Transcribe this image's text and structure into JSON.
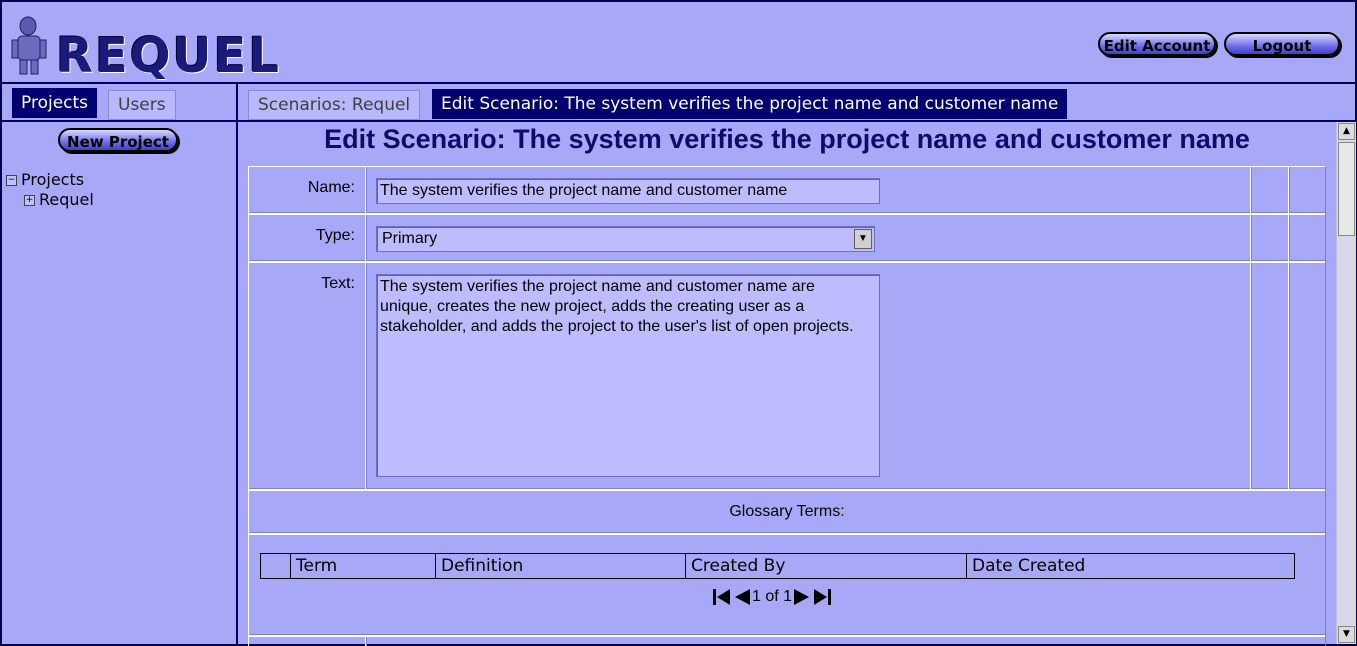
{
  "header": {
    "logo_text": "REQUEL",
    "edit_account_label": "Edit Account",
    "logout_label": "Logout"
  },
  "left_panel": {
    "tabs": [
      {
        "label": "Projects",
        "active": true
      },
      {
        "label": "Users",
        "active": false
      }
    ],
    "new_project_label": "New Project",
    "tree": {
      "root": {
        "label": "Projects",
        "toggle": "⊟"
      },
      "children": [
        {
          "label": "Requel",
          "toggle": "⊞"
        }
      ]
    }
  },
  "right_panel": {
    "tabs": [
      {
        "label": "Scenarios: Requel",
        "active": false
      },
      {
        "label": "Edit Scenario: The system verifies the project name and customer name",
        "active": true
      }
    ],
    "page_title": "Edit Scenario: The system verifies the project name and customer name",
    "form": {
      "name_label": "Name:",
      "name_value": "The system verifies the project name and customer name",
      "type_label": "Type:",
      "type_value": "Primary",
      "text_label": "Text:",
      "text_value": "The system verifies the project name and customer name are\nunique, creates the new project, adds the creating user as a\nstakeholder, and adds the project to the user's list of open projects."
    },
    "glossary": {
      "label": "Glossary Terms:",
      "columns": [
        "Term",
        "Definition",
        "Created By",
        "Date Created"
      ],
      "pager_text": "1 of 1"
    }
  },
  "colors": {
    "background": "#a8a8f8",
    "active_tab": "#000070",
    "title_text": "#0c0c6a"
  }
}
